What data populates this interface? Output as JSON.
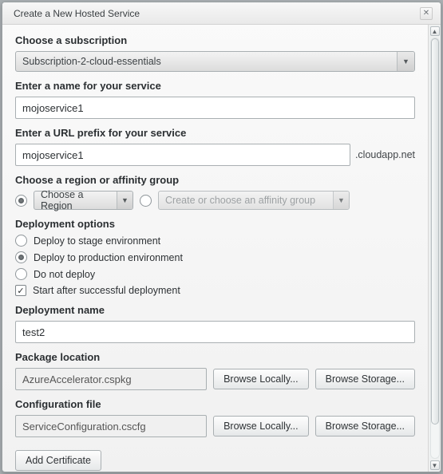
{
  "dialog": {
    "title": "Create a New Hosted Service"
  },
  "subscription": {
    "label": "Choose a subscription",
    "value": "Subscription-2-cloud-essentials"
  },
  "service_name": {
    "label": "Enter a name for your service",
    "value": "mojoservice1"
  },
  "url_prefix": {
    "label": "Enter a URL prefix for your service",
    "value": "mojoservice1",
    "suffix": ".cloudapp.net"
  },
  "region": {
    "label": "Choose a region or affinity group",
    "region_placeholder": "Choose a Region",
    "affinity_placeholder": "Create or choose an affinity group"
  },
  "deploy": {
    "label": "Deployment options",
    "options": {
      "stage": "Deploy to stage environment",
      "production": "Deploy to production environment",
      "none": "Do not deploy"
    },
    "start_after": "Start after successful deployment"
  },
  "deploy_name": {
    "label": "Deployment name",
    "value": "test2"
  },
  "package": {
    "label": "Package location",
    "value": "AzureAccelerator.cspkg"
  },
  "config": {
    "label": "Configuration file",
    "value": "ServiceConfiguration.cscfg"
  },
  "buttons": {
    "browse_local": "Browse Locally...",
    "browse_storage": "Browse Storage...",
    "add_cert": "Add Certificate"
  }
}
